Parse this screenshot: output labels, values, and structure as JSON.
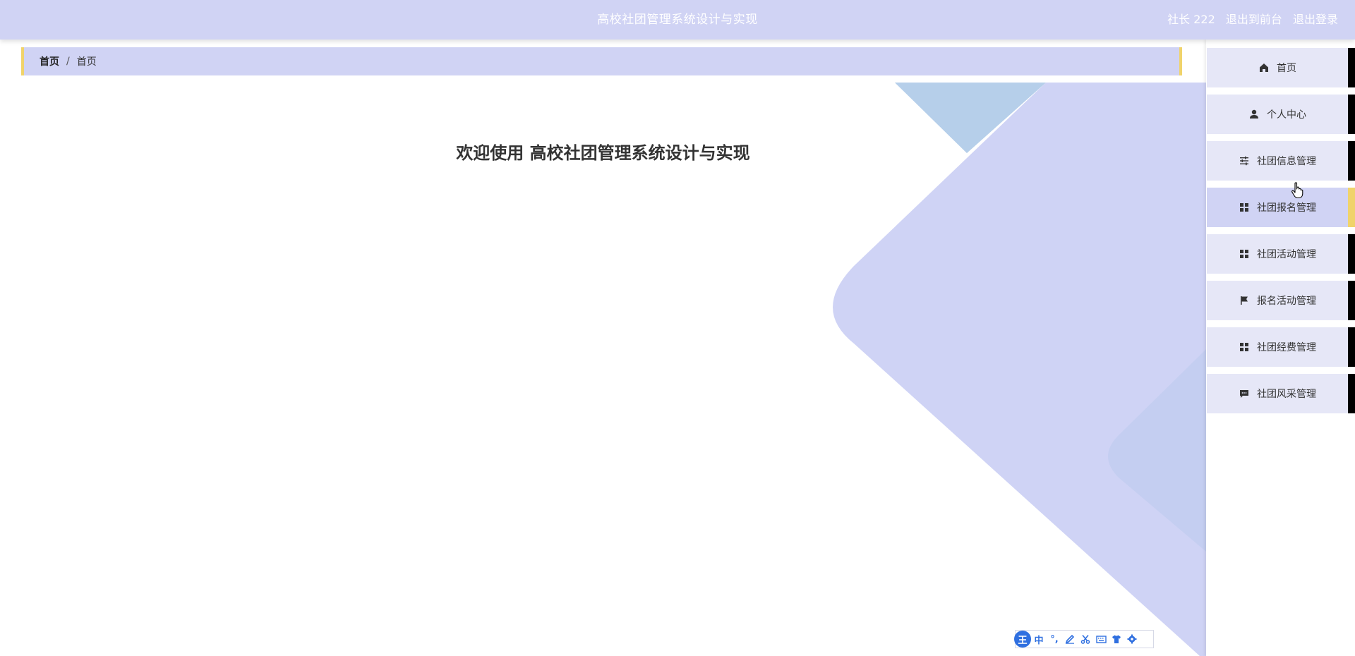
{
  "header": {
    "title": "高校社团管理系统设计与实现",
    "user": "社长 222",
    "back_to_front": "退出到前台",
    "logout": "退出登录"
  },
  "breadcrumb": {
    "home": "首页",
    "separator": "/",
    "current": "首页"
  },
  "main": {
    "welcome": "欢迎使用 高校社团管理系统设计与实现"
  },
  "sidebar": {
    "items": [
      {
        "label": "首页",
        "icon": "home-icon"
      },
      {
        "label": "个人中心",
        "icon": "user-icon"
      },
      {
        "label": "社团信息管理",
        "icon": "sliders-icon"
      },
      {
        "label": "社团报名管理",
        "icon": "grid-icon",
        "active": true
      },
      {
        "label": "社团活动管理",
        "icon": "grid-icon"
      },
      {
        "label": "报名活动管理",
        "icon": "flag-icon"
      },
      {
        "label": "社团经费管理",
        "icon": "grid-icon"
      },
      {
        "label": "社团风采管理",
        "icon": "message-icon"
      }
    ]
  },
  "ime_toolbar": {
    "logo": "王",
    "mode": "中",
    "punct": "°,",
    "buttons": [
      "pen-icon",
      "scissors-icon",
      "keyboard-icon",
      "shirt-icon",
      "settings-icon"
    ]
  },
  "colors": {
    "header_bg": "#d0d3f4",
    "accent": "#f0d36b",
    "nav_bg": "#e6e7f7",
    "shape": "#cfd3f5",
    "shape_light": "#b6cfea"
  }
}
